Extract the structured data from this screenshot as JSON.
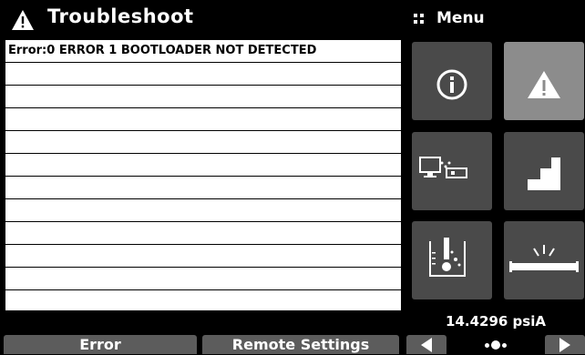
{
  "header": {
    "title": "Troubleshoot",
    "icon": "warning-icon"
  },
  "menu": {
    "label": "Menu",
    "icon": "grid-dots-icon"
  },
  "error_list": {
    "rows": [
      "Error:0 ERROR 1 BOOTLOADER NOT DETECTED",
      "",
      "",
      "",
      "",
      "",
      "",
      "",
      "",
      "",
      "",
      ""
    ]
  },
  "tiles": [
    {
      "name": "info-tile",
      "icon": "info-icon",
      "active": false
    },
    {
      "name": "troubleshoot-tile",
      "icon": "warning-icon",
      "active": true
    },
    {
      "name": "remote-tile",
      "icon": "computer-connection-icon",
      "active": false
    },
    {
      "name": "steps-tile",
      "icon": "stairs-icon",
      "active": false
    },
    {
      "name": "measurement-tile",
      "icon": "beaker-icon",
      "active": false
    },
    {
      "name": "leak-tile",
      "icon": "pipe-leak-icon",
      "active": false
    }
  ],
  "status": {
    "pressure": "14.4296 psiA"
  },
  "tabs": {
    "error": "Error",
    "remote": "Remote Settings"
  },
  "colors": {
    "tile": "#4a4a4a",
    "tile_active": "#8c8c8c",
    "tab": "#5c5c5c"
  }
}
